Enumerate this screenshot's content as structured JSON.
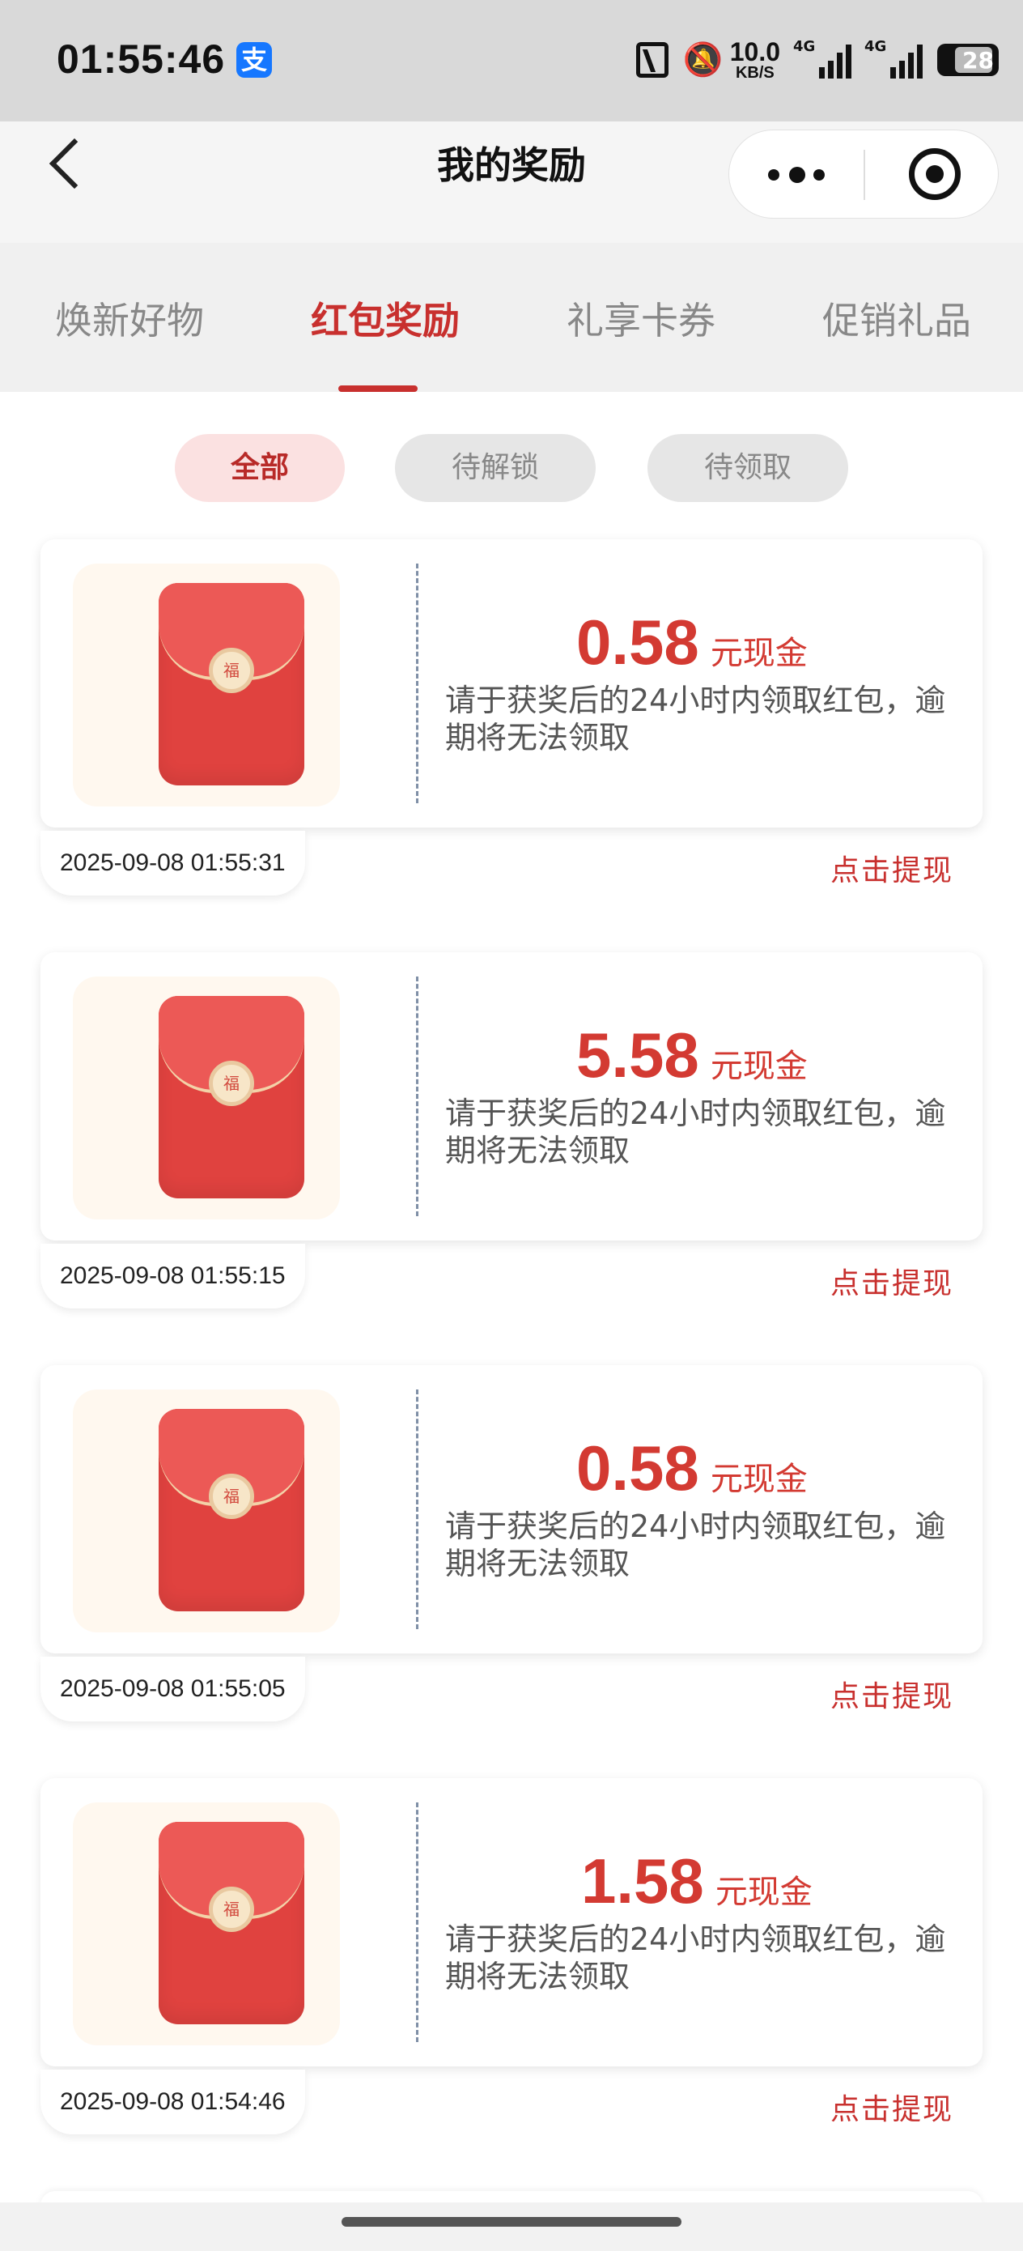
{
  "status_bar": {
    "time": "01:55:46",
    "alipay_glyph": "支",
    "net_speed_value": "10.0",
    "net_speed_unit": "KB/S",
    "signal1_label": "4G",
    "signal2_label": "4G",
    "battery_level": "28"
  },
  "header": {
    "title": "我的奖励"
  },
  "tabs": [
    {
      "label": "焕新好物"
    },
    {
      "label": "红包奖励"
    },
    {
      "label": "礼享卡券"
    },
    {
      "label": "促销礼品"
    }
  ],
  "filters": [
    {
      "label": "全部"
    },
    {
      "label": "待解锁"
    },
    {
      "label": "待领取"
    }
  ],
  "cards": [
    {
      "amount": "0.58",
      "unit": "元现金",
      "desc": "请于获奖后的24小时内领取红包，逾期将无法领取",
      "date": "2025-09-08 01:55:31",
      "action": "点击提现",
      "seal": "福"
    },
    {
      "amount": "5.58",
      "unit": "元现金",
      "desc": "请于获奖后的24小时内领取红包，逾期将无法领取",
      "date": "2025-09-08 01:55:15",
      "action": "点击提现",
      "seal": "福"
    },
    {
      "amount": "0.58",
      "unit": "元现金",
      "desc": "请于获奖后的24小时内领取红包，逾期将无法领取",
      "date": "2025-09-08 01:55:05",
      "action": "点击提现",
      "seal": "福"
    },
    {
      "amount": "1.58",
      "unit": "元现金",
      "desc": "请于获奖后的24小时内领取红包，逾期将无法领取",
      "date": "2025-09-08 01:54:46",
      "action": "点击提现",
      "seal": "福"
    }
  ],
  "colors": {
    "accent": "#c8302e",
    "amount": "#d33a32",
    "envelope": "#e0423f"
  }
}
